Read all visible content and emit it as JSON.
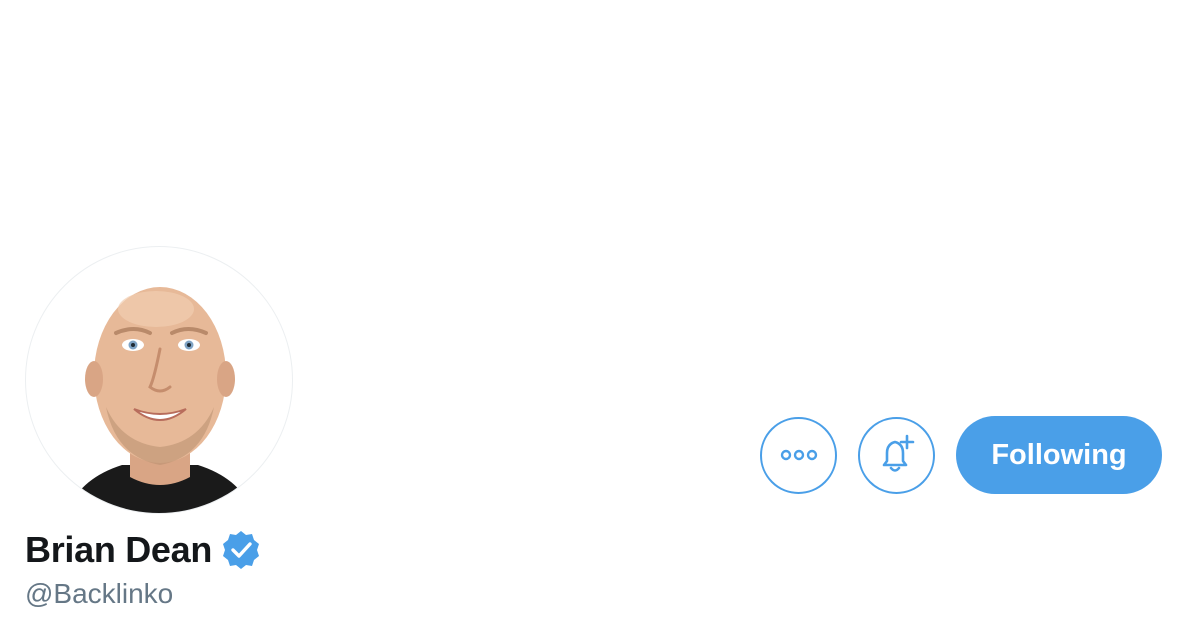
{
  "profile": {
    "display_name": "Brian Dean",
    "handle": "@Backlinko",
    "verified_icon": "verified-badge-icon",
    "avatar_icon": "profile-photo"
  },
  "actions": {
    "more_icon": "more-options-icon",
    "notify_icon": "bell-plus-icon",
    "follow_label": "Following"
  },
  "colors": {
    "accent": "#4a9fe8",
    "name_text": "#14171a",
    "handle_text": "#657786"
  }
}
